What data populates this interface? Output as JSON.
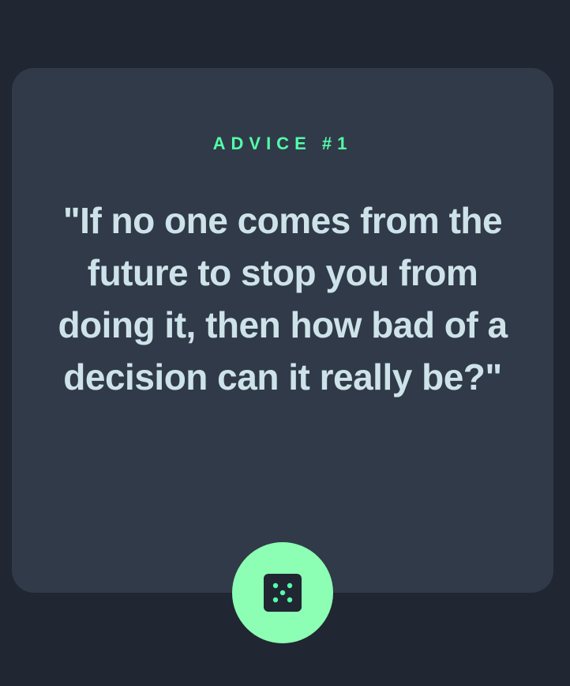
{
  "advice": {
    "label": "Advice",
    "number": "1",
    "quote": "If no one comes from the future to stop you from doing it, then how bad of a decision can it really be?"
  },
  "dice_button": {
    "icon": "dice-icon",
    "accent_color": "#53ffaa"
  },
  "colors": {
    "background": "#202632",
    "card": "#313a48",
    "text": "#cee3e9",
    "accent": "#53ffaa"
  }
}
